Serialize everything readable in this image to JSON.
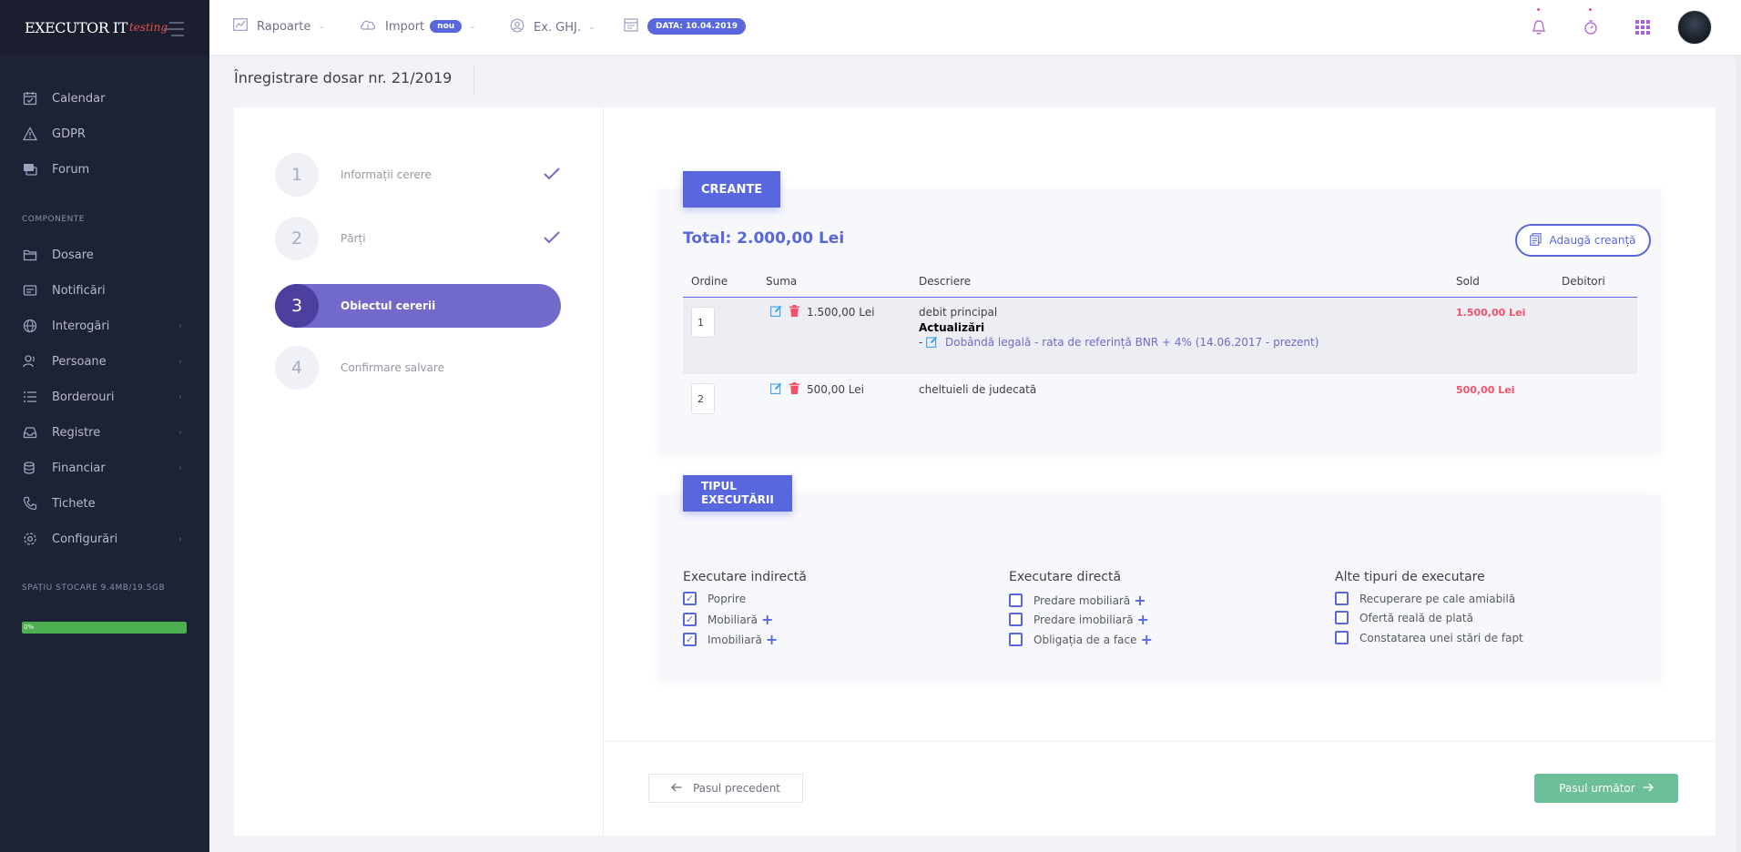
{
  "brand": {
    "main": "EXECUTOR IT",
    "sub": "testing"
  },
  "sidebar": {
    "top_items": [
      {
        "label": "Calendar",
        "icon": "calendar-icon"
      },
      {
        "label": "GDPR",
        "icon": "warning-icon"
      },
      {
        "label": "Forum",
        "icon": "chat-icon"
      }
    ],
    "section_label": "COMPONENTE",
    "items": [
      {
        "label": "Dosare",
        "icon": "folder-icon",
        "arrow": false
      },
      {
        "label": "Notificări",
        "icon": "notification-icon",
        "arrow": false
      },
      {
        "label": "Interogări",
        "icon": "globe-icon",
        "arrow": true
      },
      {
        "label": "Persoane",
        "icon": "users-icon",
        "arrow": true
      },
      {
        "label": "Borderouri",
        "icon": "list-icon",
        "arrow": true
      },
      {
        "label": "Registre",
        "icon": "inbox-icon",
        "arrow": true
      },
      {
        "label": "Financiar",
        "icon": "coins-icon",
        "arrow": true
      },
      {
        "label": "Tichete",
        "icon": "phone-icon",
        "arrow": false
      },
      {
        "label": "Configurări",
        "icon": "gear-icon",
        "arrow": true
      }
    ],
    "storage_label": "SPAȚIU STOCARE 9.4MB/19.5GB",
    "storage_percent_label": "0%",
    "storage_fraction": 0.001
  },
  "header": {
    "menu": [
      {
        "label": "Rapoarte",
        "icon": "chart-icon"
      },
      {
        "label": "Import",
        "icon": "cloud-upload-icon",
        "badge": "nou"
      },
      {
        "label": "Ex. GHJ.",
        "icon": "user-circle-icon"
      }
    ],
    "date_badge": "DATA: 10.04.2019"
  },
  "page": {
    "title": "Înregistrare dosar nr. 21/2019"
  },
  "wizard": {
    "steps": [
      {
        "num": "1",
        "label": "Informații cerere",
        "done": true
      },
      {
        "num": "2",
        "label": "Părți",
        "done": true
      },
      {
        "num": "3",
        "label": "Obiectul cererii",
        "active": true
      },
      {
        "num": "4",
        "label": "Confirmare salvare"
      }
    ]
  },
  "creante": {
    "tag": "CREANTE",
    "total": "Total: 2.000,00 Lei",
    "add_button": "Adaugă creanță",
    "columns": [
      "Ordine",
      "Suma",
      "Descriere",
      "Sold",
      "Debitori"
    ],
    "rows": [
      {
        "order": "1",
        "sum": "1.500,00 Lei",
        "description": "debit principal",
        "updates_title": "Actualizări",
        "update_item": "Dobândă legală - rata de referință BNR + 4% (14.06.2017 - prezent)",
        "sold": "1.500,00 Lei"
      },
      {
        "order": "2",
        "sum": "500,00 Lei",
        "description": "cheltuieli de judecată",
        "sold": "500,00 Lei"
      }
    ]
  },
  "tipul": {
    "tag_line1": "TIPUL",
    "tag_line2": "EXECUTĂRII",
    "columns": [
      {
        "title": "Executare indirectă",
        "options": [
          {
            "label": "Poprire",
            "checked": true,
            "plus": false
          },
          {
            "label": "Mobiliară",
            "checked": true,
            "plus": true
          },
          {
            "label": "Imobiliară",
            "checked": true,
            "plus": true
          }
        ]
      },
      {
        "title": "Executare directă",
        "options": [
          {
            "label": "Predare mobiliară",
            "checked": false,
            "plus": true
          },
          {
            "label": "Predare imobiliară",
            "checked": false,
            "plus": true
          },
          {
            "label": "Obligația de a face",
            "checked": false,
            "plus": true
          }
        ]
      },
      {
        "title": "Alte tipuri de executare",
        "options": [
          {
            "label": "Recuperare pe cale amiabilă",
            "checked": false,
            "plus": false
          },
          {
            "label": "Ofertă reală de plată",
            "checked": false,
            "plus": false
          },
          {
            "label": "Constatarea unei stări de fapt",
            "checked": false,
            "plus": false
          }
        ]
      }
    ]
  },
  "footer": {
    "prev": "Pasul precedent",
    "next": "Pasul următor"
  },
  "colors": {
    "accent": "#5867dd",
    "wizard_active": "#716aca",
    "danger": "#f4516c",
    "success": "#6cbf98",
    "sidebar": "#1e2235"
  }
}
